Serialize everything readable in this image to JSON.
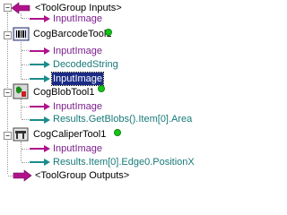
{
  "tree": {
    "toolgroup_inputs": "<ToolGroup Inputs>",
    "toolgroup_outputs": "<ToolGroup Outputs>",
    "tools": [
      {
        "name": "CogBarcodeTool1",
        "status": "ok",
        "terminals": [
          {
            "label": "InputImage",
            "direction": "input"
          },
          {
            "label": "DecodedString",
            "direction": "output"
          },
          {
            "label": "InputImage",
            "direction": "output",
            "selected": true
          }
        ]
      },
      {
        "name": "CogBlobTool1",
        "status": "ok",
        "terminals": [
          {
            "label": "InputImage",
            "direction": "input"
          },
          {
            "label": "Results.GetBlobs().Item[0].Area",
            "direction": "output"
          }
        ]
      },
      {
        "name": "CogCaliperTool1",
        "status": "ok",
        "terminals": [
          {
            "label": "InputImage",
            "direction": "input"
          },
          {
            "label": "Results.Item[0].Edge0.PositionX",
            "direction": "output"
          }
        ]
      }
    ],
    "group_input_terminal": "InputImage",
    "colors": {
      "input_arrow": "#b0128c",
      "output_arrow": "#1a8d8b",
      "status_ok": "#18c418",
      "selection": "#1a2b86"
    },
    "icons": {
      "group_input": "input-arrow-icon",
      "group_output": "output-arrow-icon",
      "barcode_tool": "barcode-icon",
      "blob_tool": "blob-icon",
      "caliper_tool": "caliper-icon"
    }
  }
}
